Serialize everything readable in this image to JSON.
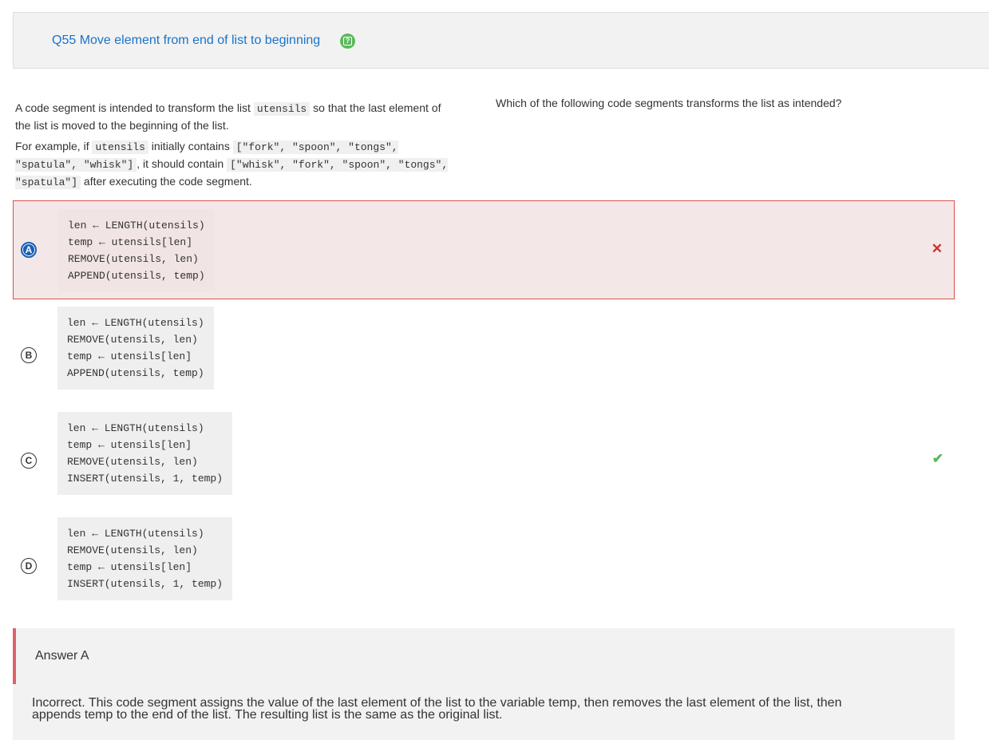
{
  "header": {
    "title": "Q55 Move element from end of list to beginning",
    "help_icon": "help-icon"
  },
  "prompt": {
    "p1_a": "A code segment is intended to transform the list ",
    "p1_code": "utensils",
    "p1_b": " so that the last element of the list is moved to the beginning of the list.",
    "p2_a": "For example, if ",
    "p2_code1": "utensils",
    "p2_b": " initially contains ",
    "p2_code2": "[\"fork\", \"spoon\", \"tongs\", \"spatula\", \"whisk\"]",
    "p2_c": ", it should contain ",
    "p2_code3": "[\"whisk\", \"fork\", \"spoon\", \"tongs\", \"spatula\"]",
    "p2_d": " after executing the code segment."
  },
  "question": "Which of the following code segments transforms the list as intended?",
  "options": [
    {
      "letter": "A",
      "code": "len ← LENGTH(utensils)\ntemp ← utensils[len]\nREMOVE(utensils, len)\nAPPEND(utensils, temp)",
      "status": "incorrect",
      "mark": "✕"
    },
    {
      "letter": "B",
      "code": "len ← LENGTH(utensils)\nREMOVE(utensils, len)\ntemp ← utensils[len]\nAPPEND(utensils, temp)",
      "status": "",
      "mark": ""
    },
    {
      "letter": "C",
      "code": "len ← LENGTH(utensils)\ntemp ← utensils[len]\nREMOVE(utensils, len)\nINSERT(utensils, 1, temp)",
      "status": "correct",
      "mark": "✔"
    },
    {
      "letter": "D",
      "code": "len ← LENGTH(utensils)\nREMOVE(utensils, len)\ntemp ← utensils[len]\nINSERT(utensils, 1, temp)",
      "status": "",
      "mark": ""
    }
  ],
  "answer": {
    "title": "Answer A",
    "explanation": "Incorrect. This code segment assigns the value of the last element of the list to the variable  temp,  then removes the last element of the list, then appends  temp  to the end of the list. The resulting list is the same as the original list."
  },
  "colors": {
    "title_blue": "#1a73c8",
    "help_green": "#5cb85c",
    "wrong_red": "#c9302c",
    "correct_green": "#5cb85c",
    "answer_bar": "#e0616b"
  }
}
